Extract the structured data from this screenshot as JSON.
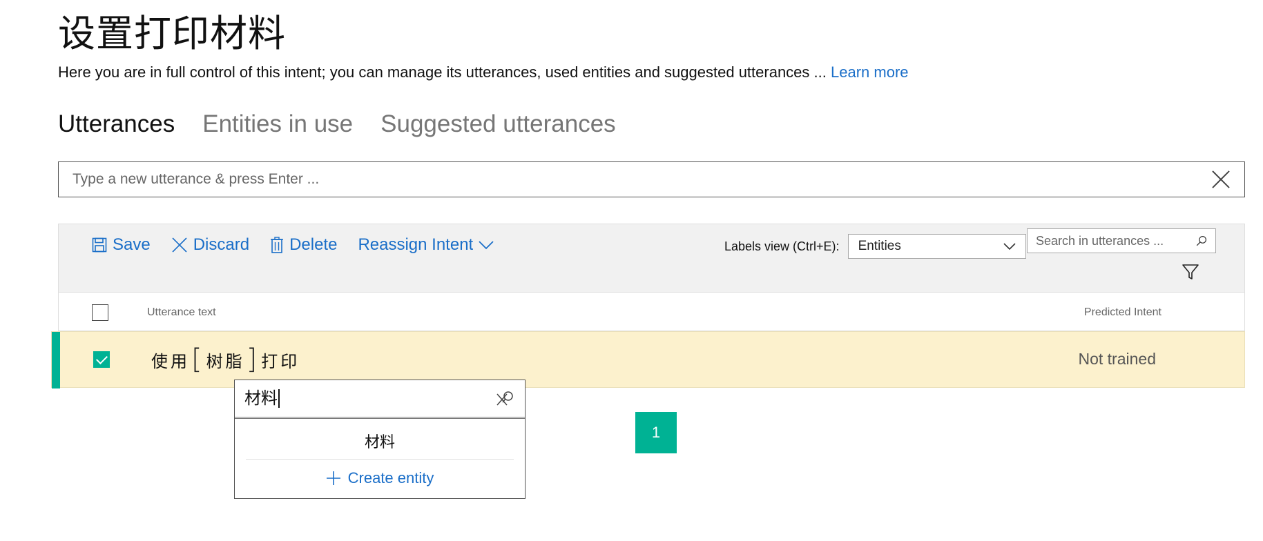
{
  "page": {
    "title": "设置打印材料",
    "description": "Here you are in full control of this intent; you can manage its utterances, used entities and suggested utterances ...",
    "learn_more": "Learn more"
  },
  "tabs": [
    {
      "label": "Utterances",
      "active": true
    },
    {
      "label": "Entities in use",
      "active": false
    },
    {
      "label": "Suggested utterances",
      "active": false
    }
  ],
  "utterance_input": {
    "placeholder": "Type a new utterance & press Enter ...",
    "value": ""
  },
  "toolbar": {
    "save_label": "Save",
    "discard_label": "Discard",
    "delete_label": "Delete",
    "reassign_label": "Reassign Intent",
    "labels_view_label": "Labels view (Ctrl+E):",
    "labels_view_value": "Entities",
    "search_placeholder": "Search in utterances ..."
  },
  "table": {
    "columns": {
      "utterance": "Utterance text",
      "intent": "Predicted Intent"
    },
    "rows": [
      {
        "prefix": "使用",
        "entity": "树脂",
        "suffix": "打印",
        "predicted": "Not trained",
        "checked": true
      }
    ]
  },
  "entity_popup": {
    "query": "材料",
    "option": "材料",
    "create_label": "Create entity"
  },
  "pagination": {
    "current": "1"
  },
  "colors": {
    "accent": "#00b294",
    "link": "#1a6ec8",
    "row_highlight": "#fcf1cd"
  }
}
